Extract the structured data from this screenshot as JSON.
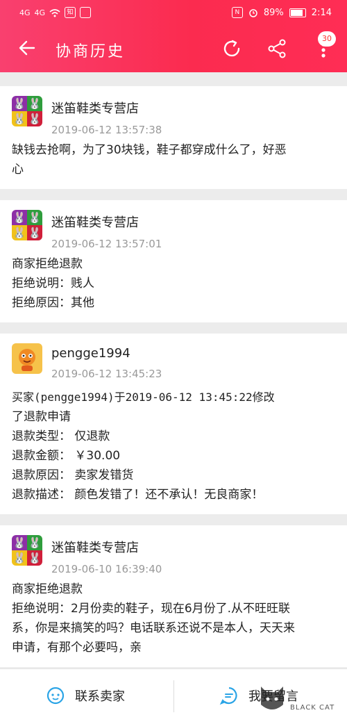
{
  "status_bar": {
    "signal_1": "4G",
    "signal_2": "4G",
    "app_icon_1": "知",
    "battery": "89%",
    "time": "2:14"
  },
  "toolbar": {
    "title": "协商历史",
    "more_badge": "30"
  },
  "messages": [
    {
      "name": "迷笛鞋类专营店",
      "time": "2019-06-12 13:57:38",
      "lines": [
        "缺钱去抢啊，为了30块钱，鞋子都穿成什么了，好恶",
        "心"
      ]
    },
    {
      "name": "迷笛鞋类专营店",
      "time": "2019-06-12 13:57:01",
      "lines": [
        "商家拒绝退款",
        "拒绝说明：贱人",
        "拒绝原因：其他"
      ]
    },
    {
      "name": "pengge1994",
      "time": "2019-06-12 13:45:23",
      "lines": [
        "买家(pengge1994)于2019-06-12 13:45:22修改",
        "了退款申请",
        "退款类型： 仅退款",
        "退款金额： ￥30.00",
        "退款原因： 卖家发错货",
        "退款描述： 颜色发错了！还不承认！无良商家！"
      ]
    },
    {
      "name": "迷笛鞋类专营店",
      "time": "2019-06-10 16:39:40",
      "lines": [
        "商家拒绝退款",
        "拒绝说明：2月份卖的鞋子，现在6月份了.从不旺旺联",
        "系，你是来搞笑的吗？电话联系还说不是本人，天天来",
        "申请，有那个必要吗，亲"
      ]
    }
  ],
  "bottom_bar": {
    "contact_label": "联系卖家",
    "message_label": "我要留言"
  },
  "watermark": {
    "text": "BLACK CAT"
  },
  "colors": {
    "header_start": "#f9406f",
    "header_end": "#ff2d55",
    "accent_icon": "#2aa4e6"
  }
}
